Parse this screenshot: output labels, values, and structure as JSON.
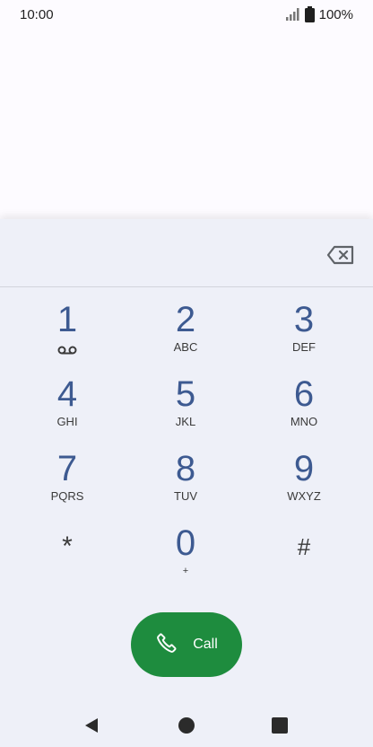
{
  "status_bar": {
    "time": "10:00",
    "battery": "100%",
    "icons": [
      "signal-icon",
      "battery-icon"
    ]
  },
  "number_field": {
    "value": "",
    "backspace_icon": "backspace-icon"
  },
  "keypad": {
    "keys": [
      {
        "digit": "1",
        "letters": "",
        "icon": "voicemail-icon"
      },
      {
        "digit": "2",
        "letters": "ABC"
      },
      {
        "digit": "3",
        "letters": "DEF"
      },
      {
        "digit": "4",
        "letters": "GHI"
      },
      {
        "digit": "5",
        "letters": "JKL"
      },
      {
        "digit": "6",
        "letters": "MNO"
      },
      {
        "digit": "7",
        "letters": "PQRS"
      },
      {
        "digit": "8",
        "letters": "TUV"
      },
      {
        "digit": "9",
        "letters": "WXYZ"
      },
      {
        "digit": "*",
        "letters": ""
      },
      {
        "digit": "0",
        "letters": "+"
      },
      {
        "digit": "#",
        "letters": ""
      }
    ]
  },
  "call_button": {
    "label": "Call",
    "icon": "phone-icon"
  },
  "nav": {
    "icons": [
      "back-icon",
      "home-icon",
      "recents-icon"
    ]
  },
  "colors": {
    "digit": "#3d5a91",
    "call_green": "#1e8c3e",
    "sheet_bg": "#eef0f8"
  }
}
